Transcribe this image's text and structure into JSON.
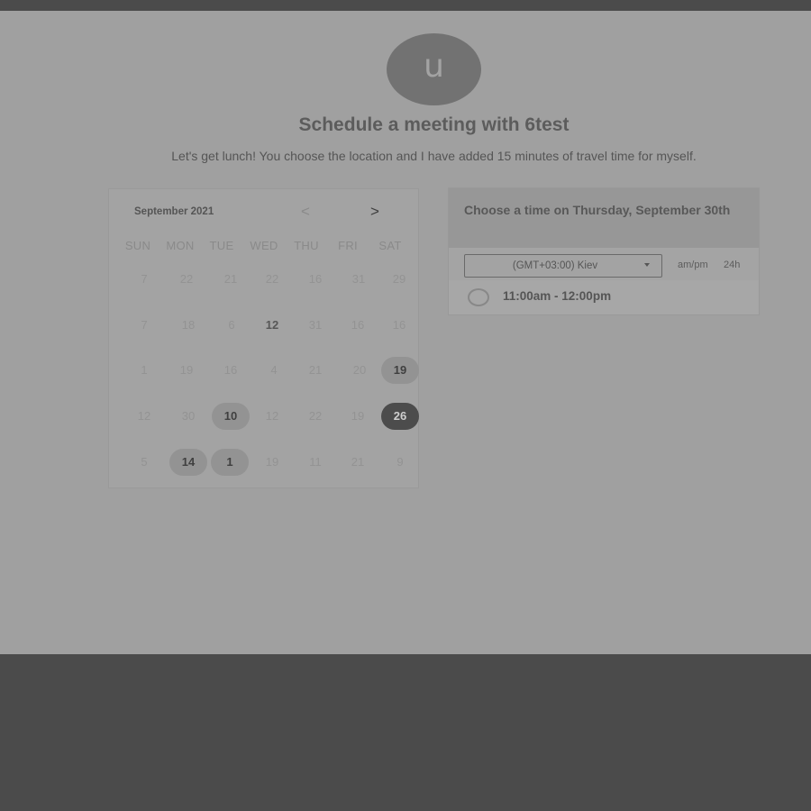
{
  "colors": {
    "page_bg": "#a0a0a0",
    "frame_bg": "#4b4b4b",
    "avatar_bg": "#727272",
    "selected_day": "#4c4c4c",
    "highlight_day": "#939393"
  },
  "avatar": {
    "initial": "u"
  },
  "header": {
    "title": "Schedule a meeting with 6test",
    "subtitle": "Let's get lunch! You choose the location and I have added 15 minutes of travel time for myself."
  },
  "calendar": {
    "month_label": "September 2021",
    "prev_icon": "<",
    "next_icon": ">",
    "weekdays": [
      "SUN",
      "MON",
      "TUE",
      "WED",
      "THU",
      "FRI",
      "SAT"
    ],
    "weeks": [
      [
        "7",
        "22",
        "21",
        "22",
        "16",
        "31",
        "29"
      ],
      [
        "7",
        "18",
        "6",
        "12",
        "31",
        "16",
        "16"
      ],
      [
        "1",
        "19",
        "16",
        "4",
        "21",
        "20",
        "19"
      ],
      [
        "12",
        "30",
        "10",
        "12",
        "22",
        "19",
        "26"
      ],
      [
        "5",
        "14",
        "1",
        "19",
        "11",
        "21",
        "9"
      ]
    ]
  },
  "time_panel": {
    "heading": "Choose a time on Thursday, September 30th",
    "timezone": "(GMT+03:00) Kiev",
    "format_ampm": "am/pm",
    "format_24h": "24h",
    "slots": [
      "11:00am - 12:00pm"
    ]
  }
}
